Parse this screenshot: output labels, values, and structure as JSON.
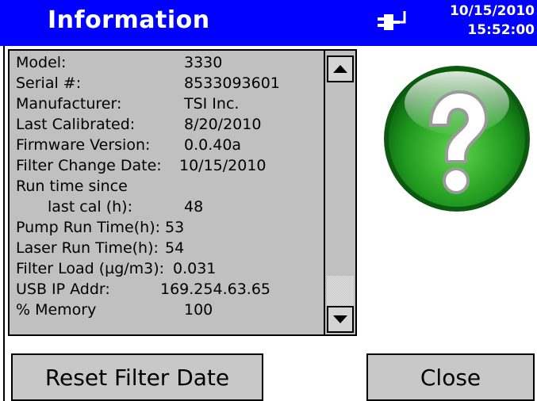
{
  "title_bar": {
    "title": "Information",
    "date": "10/15/2010",
    "time": "15:52:00",
    "connection_icon": "power-plug-icon",
    "background_color": "#0000ff"
  },
  "info": {
    "model_label": "Model:",
    "model_value": "3330",
    "serial_label": "Serial #:",
    "serial_value": "8533093601",
    "manufacturer_label": "Manufacturer:",
    "manufacturer_value": "TSI Inc.",
    "last_calibrated_label": "Last Calibrated:",
    "last_calibrated_value": "8/20/2010",
    "firmware_label": "Firmware Version:",
    "firmware_value": "0.0.40a",
    "filter_change_label": "Filter Change Date:",
    "filter_change_value": "10/15/2010",
    "run_time_label_1": "Run time since",
    "run_time_label_2": "last cal (h):",
    "run_time_value": "48",
    "pump_label": "Pump Run Time(h):",
    "pump_value": "53",
    "laser_label": "Laser Run Time(h):",
    "laser_value": "54",
    "filter_load_label": "Filter Load (µg/m3):",
    "filter_load_value": "0.031",
    "usb_label": "USB IP Addr:",
    "usb_value": "169.254.63.65",
    "memory_label": "% Memory",
    "memory_value": "100"
  },
  "scrollbar": {
    "up_icon": "arrow-up-icon",
    "down_icon": "arrow-down-icon"
  },
  "help_icon": "question-mark-icon",
  "buttons": {
    "reset_filter_date": "Reset Filter Date",
    "close": "Close"
  }
}
